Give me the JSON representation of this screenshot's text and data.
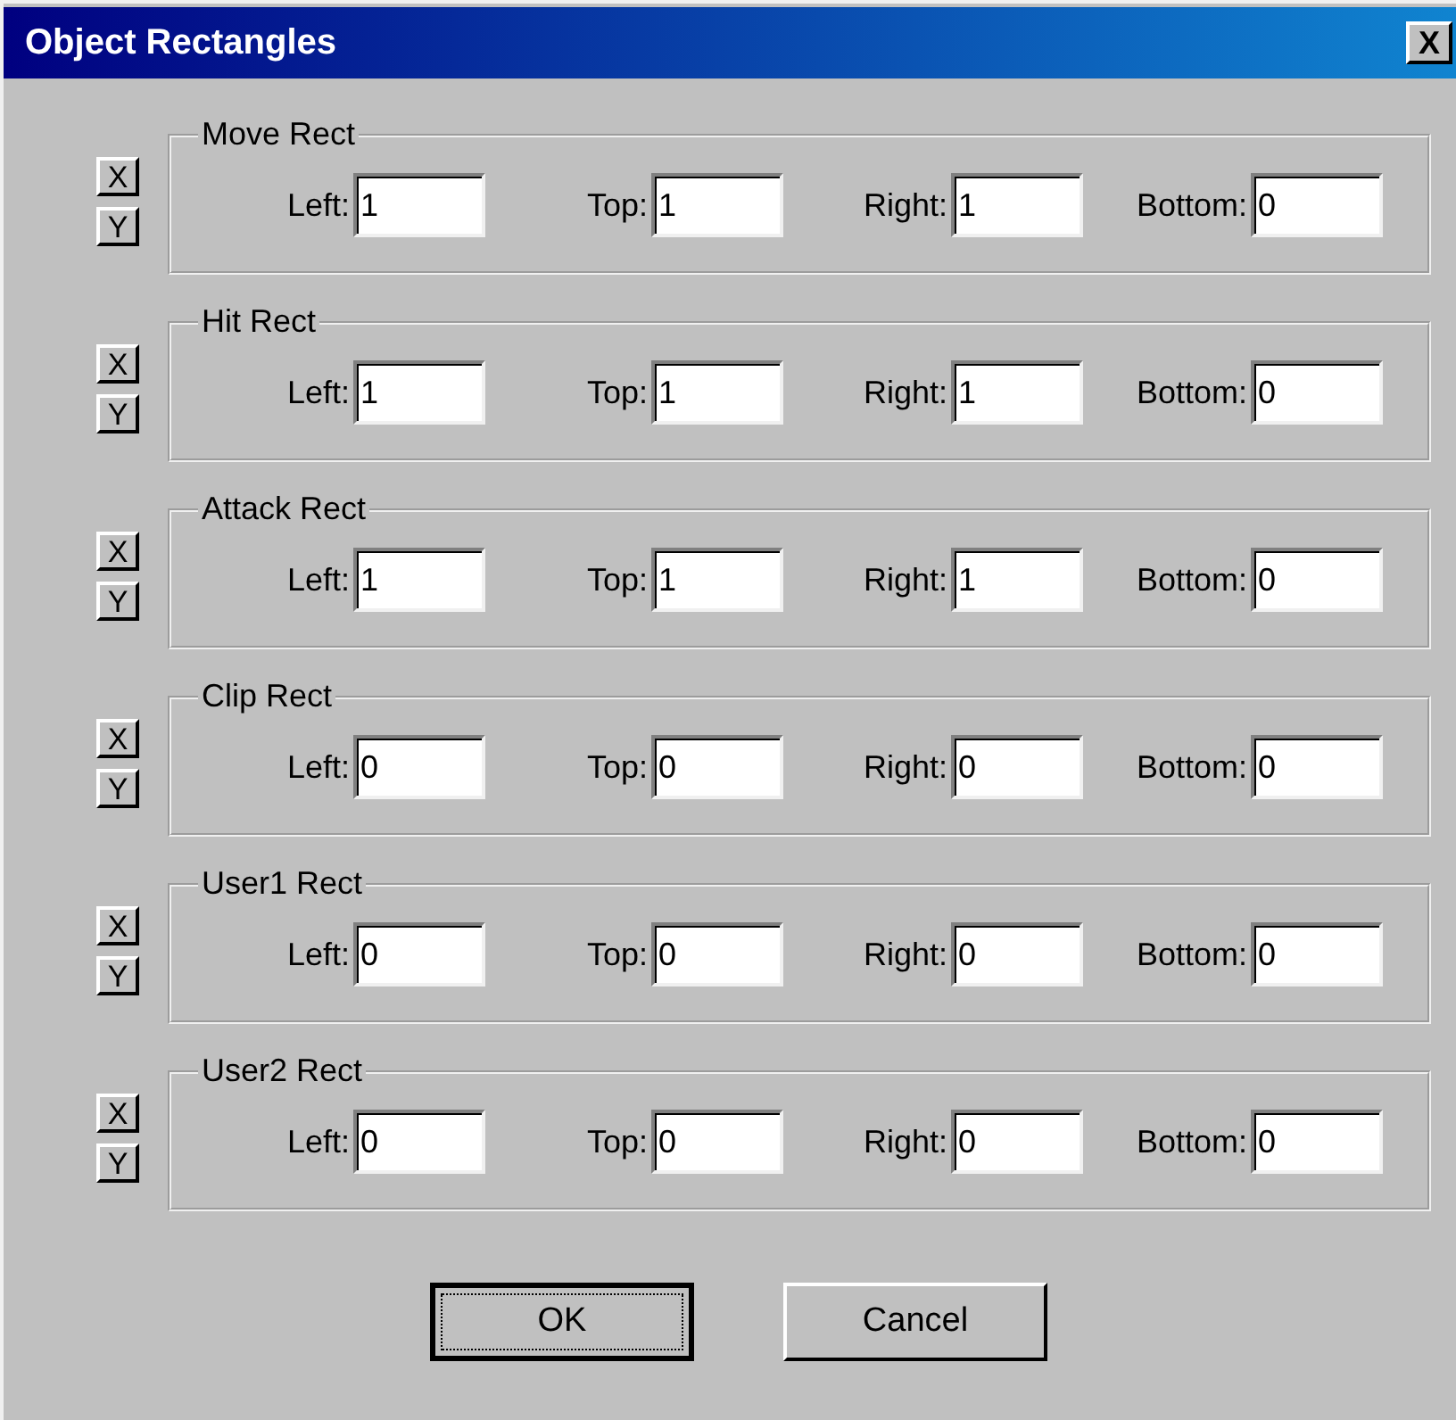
{
  "window": {
    "title": "Object Rectangles",
    "close": "X"
  },
  "groups": [
    {
      "title": "Move Rect",
      "axis_buttons": [
        "X",
        "Y"
      ],
      "fields": [
        {
          "label": "Left:",
          "value": "1"
        },
        {
          "label": "Top:",
          "value": "1"
        },
        {
          "label": "Right:",
          "value": "1"
        },
        {
          "label": "Bottom:",
          "value": "0"
        }
      ]
    },
    {
      "title": "Hit Rect",
      "axis_buttons": [
        "X",
        "Y"
      ],
      "fields": [
        {
          "label": "Left:",
          "value": "1"
        },
        {
          "label": "Top:",
          "value": "1"
        },
        {
          "label": "Right:",
          "value": "1"
        },
        {
          "label": "Bottom:",
          "value": "0"
        }
      ]
    },
    {
      "title": "Attack Rect",
      "axis_buttons": [
        "X",
        "Y"
      ],
      "fields": [
        {
          "label": "Left:",
          "value": "1"
        },
        {
          "label": "Top:",
          "value": "1"
        },
        {
          "label": "Right:",
          "value": "1"
        },
        {
          "label": "Bottom:",
          "value": "0"
        }
      ]
    },
    {
      "title": "Clip Rect",
      "axis_buttons": [
        "X",
        "Y"
      ],
      "fields": [
        {
          "label": "Left:",
          "value": "0"
        },
        {
          "label": "Top:",
          "value": "0"
        },
        {
          "label": "Right:",
          "value": "0"
        },
        {
          "label": "Bottom:",
          "value": "0"
        }
      ]
    },
    {
      "title": "User1 Rect",
      "axis_buttons": [
        "X",
        "Y"
      ],
      "fields": [
        {
          "label": "Left:",
          "value": "0"
        },
        {
          "label": "Top:",
          "value": "0"
        },
        {
          "label": "Right:",
          "value": "0"
        },
        {
          "label": "Bottom:",
          "value": "0"
        }
      ]
    },
    {
      "title": "User2 Rect",
      "axis_buttons": [
        "X",
        "Y"
      ],
      "fields": [
        {
          "label": "Left:",
          "value": "0"
        },
        {
          "label": "Top:",
          "value": "0"
        },
        {
          "label": "Right:",
          "value": "0"
        },
        {
          "label": "Bottom:",
          "value": "0"
        }
      ]
    }
  ],
  "buttons": [
    {
      "label": "OK",
      "default": true
    },
    {
      "label": "Cancel",
      "default": false
    }
  ]
}
